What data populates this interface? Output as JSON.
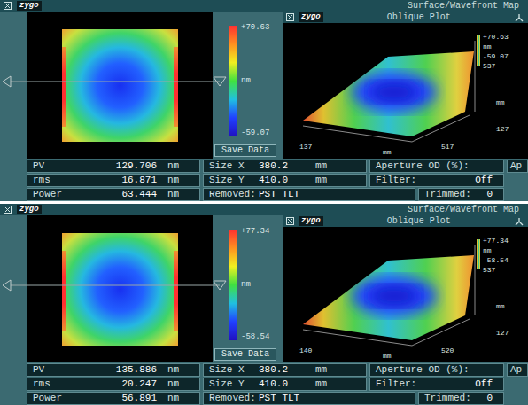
{
  "panels": [
    {
      "window": {
        "title": "Surface/Wavefront Map",
        "logo": "zygo"
      },
      "map": {
        "scale_max": "+70.63",
        "scale_unit": "nm",
        "scale_min": "-59.07",
        "save_button": "Save Data"
      },
      "oblique": {
        "title": "Oblique Plot",
        "logo": "zygo",
        "scale_max": "+70.63",
        "scale_unit": "nm",
        "scale_min": "-59.07",
        "z_tick": "537",
        "x_ticks": [
          "137",
          "mm",
          "517"
        ],
        "y_ticks": [
          "mm",
          "127"
        ]
      },
      "stats": [
        [
          {
            "label": "PV",
            "value": "129.706",
            "unit": "nm"
          },
          {
            "label": "Size X",
            "value": "380.2",
            "unit": "mm"
          },
          {
            "label": "Aperture OD (%):"
          },
          {
            "label": "Ap"
          }
        ],
        [
          {
            "label": "rms",
            "value": "16.871",
            "unit": "nm"
          },
          {
            "label": "Size Y",
            "value": "410.0",
            "unit": "mm"
          },
          {
            "label": "Filter:",
            "value": "Off"
          }
        ],
        [
          {
            "label": "Power",
            "value": "63.444",
            "unit": "nm"
          },
          {
            "label": "Removed:",
            "value": "PST TLT"
          },
          {
            "label": "Trimmed:",
            "value": "0"
          }
        ]
      ]
    },
    {
      "window": {
        "title": "Surface/Wavefront Map",
        "logo": "zygo"
      },
      "map": {
        "scale_max": "+77.34",
        "scale_unit": "nm",
        "scale_min": "-58.54",
        "save_button": "Save Data"
      },
      "oblique": {
        "title": "Oblique Plot",
        "logo": "zygo",
        "scale_max": "+77.34",
        "scale_unit": "nm",
        "scale_min": "-58.54",
        "z_tick": "537",
        "x_ticks": [
          "140",
          "mm",
          "520"
        ],
        "y_ticks": [
          "mm",
          "127"
        ]
      },
      "stats": [
        [
          {
            "label": "PV",
            "value": "135.886",
            "unit": "nm"
          },
          {
            "label": "Size X",
            "value": "380.2",
            "unit": "mm"
          },
          {
            "label": "Aperture OD (%):"
          },
          {
            "label": "Ap"
          }
        ],
        [
          {
            "label": "rms",
            "value": "20.247",
            "unit": "nm"
          },
          {
            "label": "Size Y",
            "value": "410.0",
            "unit": "mm"
          },
          {
            "label": "Filter:",
            "value": "Off"
          }
        ],
        [
          {
            "label": "Power",
            "value": "56.891",
            "unit": "nm"
          },
          {
            "label": "Removed:",
            "value": "PST TLT"
          },
          {
            "label": "Trimmed:",
            "value": "0"
          }
        ]
      ]
    }
  ]
}
